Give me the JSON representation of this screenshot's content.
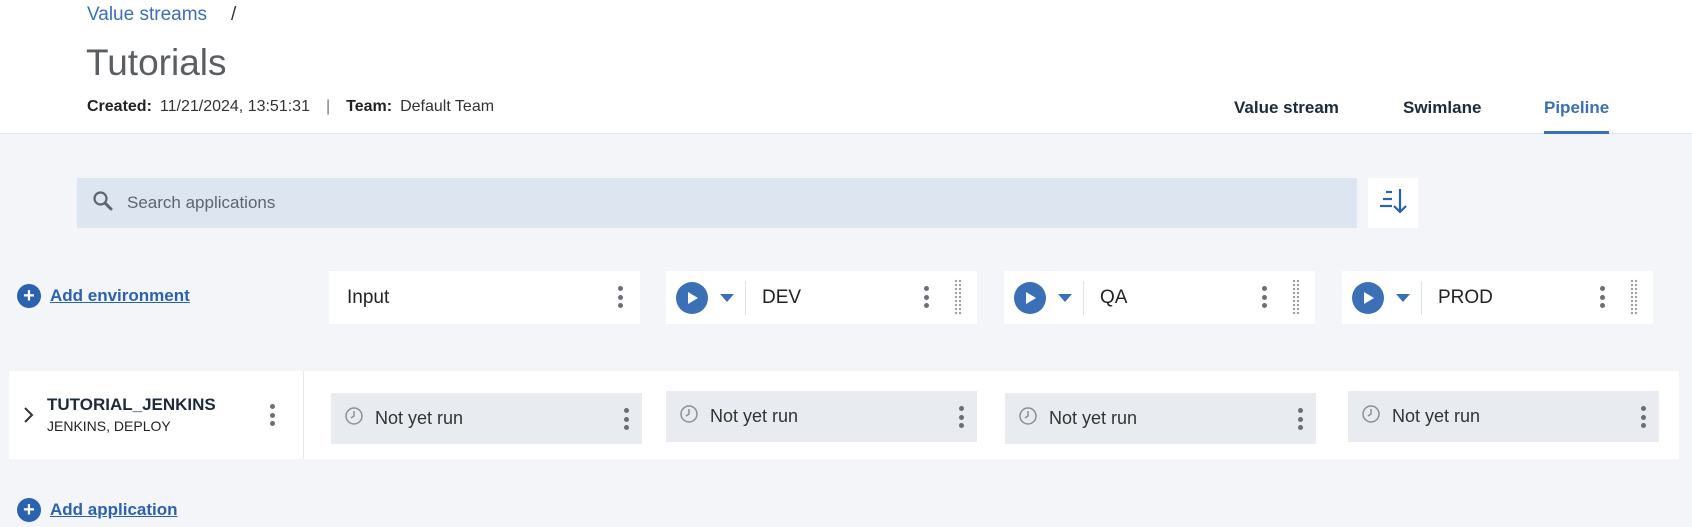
{
  "breadcrumb": {
    "link": "Value streams",
    "separator": "/"
  },
  "page": {
    "title": "Tutorials"
  },
  "meta": {
    "created_label": "Created:",
    "created_value": "11/21/2024, 13:51:31",
    "separator": "|",
    "team_label": "Team:",
    "team_value": "Default Team"
  },
  "tabs": [
    {
      "label": "Value stream",
      "active": false
    },
    {
      "label": "Swimlane",
      "active": false
    },
    {
      "label": "Pipeline",
      "active": true
    }
  ],
  "search": {
    "placeholder": "Search applications",
    "value": ""
  },
  "actions": {
    "add_environment": "Add environment",
    "add_application": "Add application"
  },
  "environments": [
    {
      "name": "Input",
      "has_play": false
    },
    {
      "name": "DEV",
      "has_play": true
    },
    {
      "name": "QA",
      "has_play": true
    },
    {
      "name": "PROD",
      "has_play": true
    }
  ],
  "applications": [
    {
      "name": "TUTORIAL_JENKINS",
      "tags": "JENKINS, DEPLOY",
      "statuses": [
        "Not yet run",
        "Not yet run",
        "Not yet run",
        "Not yet run"
      ]
    }
  ],
  "colors": {
    "accent": "#3b6fb6",
    "link": "#2a62b0",
    "search_bg": "#dde6f0",
    "page_bg": "#f3f5f8"
  },
  "icons": {
    "search": "search-icon",
    "sort": "sort-descending-icon",
    "play": "play-icon",
    "status": "clock-icon"
  }
}
